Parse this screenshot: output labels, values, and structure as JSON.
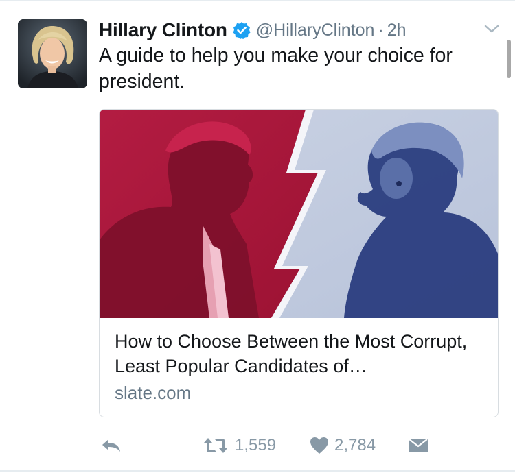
{
  "tweet": {
    "display_name": "Hillary Clinton",
    "handle": "@HillaryClinton",
    "separator": "·",
    "time": "2h",
    "text": "A guide to help you make your choice for president.",
    "verified": true
  },
  "card": {
    "title": "How to Choose Between the Most Corrupt, Least Popular Candidates of…",
    "domain": "slate.com",
    "image_colors": {
      "left_bg": "#a8183a",
      "right_bg": "#c3cce0",
      "left_figure": "#7c0f2a",
      "right_figure": "#2b3e80"
    }
  },
  "actions": {
    "reply_icon": "reply-icon",
    "retweet_icon": "retweet-icon",
    "retweet_count": "1,559",
    "like_icon": "heart-icon",
    "like_count": "2,784",
    "dm_icon": "direct-message-icon"
  },
  "colors": {
    "verified_blue": "#1da1f2",
    "secondary_text": "#657786",
    "action_gray": "#8899a6"
  }
}
